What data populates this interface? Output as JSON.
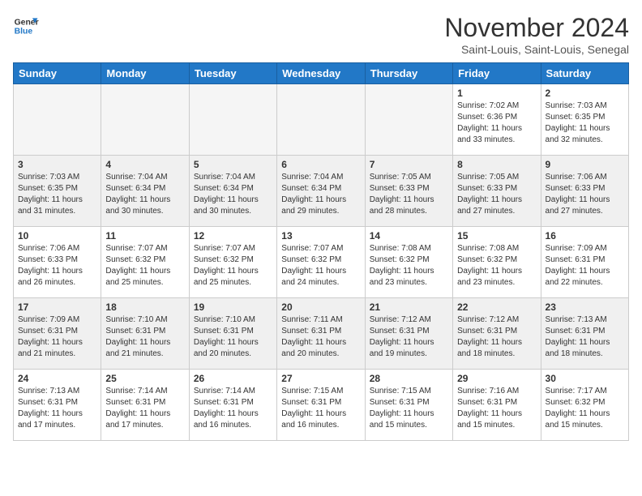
{
  "logo": {
    "line1": "General",
    "line2": "Blue"
  },
  "header": {
    "month": "November 2024",
    "location": "Saint-Louis, Saint-Louis, Senegal"
  },
  "weekdays": [
    "Sunday",
    "Monday",
    "Tuesday",
    "Wednesday",
    "Thursday",
    "Friday",
    "Saturday"
  ],
  "weeks": [
    [
      {
        "day": "",
        "info": "",
        "empty": true
      },
      {
        "day": "",
        "info": "",
        "empty": true
      },
      {
        "day": "",
        "info": "",
        "empty": true
      },
      {
        "day": "",
        "info": "",
        "empty": true
      },
      {
        "day": "",
        "info": "",
        "empty": true
      },
      {
        "day": "1",
        "info": "Sunrise: 7:02 AM\nSunset: 6:36 PM\nDaylight: 11 hours\nand 33 minutes.",
        "empty": false
      },
      {
        "day": "2",
        "info": "Sunrise: 7:03 AM\nSunset: 6:35 PM\nDaylight: 11 hours\nand 32 minutes.",
        "empty": false
      }
    ],
    [
      {
        "day": "3",
        "info": "Sunrise: 7:03 AM\nSunset: 6:35 PM\nDaylight: 11 hours\nand 31 minutes.",
        "empty": false
      },
      {
        "day": "4",
        "info": "Sunrise: 7:04 AM\nSunset: 6:34 PM\nDaylight: 11 hours\nand 30 minutes.",
        "empty": false
      },
      {
        "day": "5",
        "info": "Sunrise: 7:04 AM\nSunset: 6:34 PM\nDaylight: 11 hours\nand 30 minutes.",
        "empty": false
      },
      {
        "day": "6",
        "info": "Sunrise: 7:04 AM\nSunset: 6:34 PM\nDaylight: 11 hours\nand 29 minutes.",
        "empty": false
      },
      {
        "day": "7",
        "info": "Sunrise: 7:05 AM\nSunset: 6:33 PM\nDaylight: 11 hours\nand 28 minutes.",
        "empty": false
      },
      {
        "day": "8",
        "info": "Sunrise: 7:05 AM\nSunset: 6:33 PM\nDaylight: 11 hours\nand 27 minutes.",
        "empty": false
      },
      {
        "day": "9",
        "info": "Sunrise: 7:06 AM\nSunset: 6:33 PM\nDaylight: 11 hours\nand 27 minutes.",
        "empty": false
      }
    ],
    [
      {
        "day": "10",
        "info": "Sunrise: 7:06 AM\nSunset: 6:33 PM\nDaylight: 11 hours\nand 26 minutes.",
        "empty": false
      },
      {
        "day": "11",
        "info": "Sunrise: 7:07 AM\nSunset: 6:32 PM\nDaylight: 11 hours\nand 25 minutes.",
        "empty": false
      },
      {
        "day": "12",
        "info": "Sunrise: 7:07 AM\nSunset: 6:32 PM\nDaylight: 11 hours\nand 25 minutes.",
        "empty": false
      },
      {
        "day": "13",
        "info": "Sunrise: 7:07 AM\nSunset: 6:32 PM\nDaylight: 11 hours\nand 24 minutes.",
        "empty": false
      },
      {
        "day": "14",
        "info": "Sunrise: 7:08 AM\nSunset: 6:32 PM\nDaylight: 11 hours\nand 23 minutes.",
        "empty": false
      },
      {
        "day": "15",
        "info": "Sunrise: 7:08 AM\nSunset: 6:32 PM\nDaylight: 11 hours\nand 23 minutes.",
        "empty": false
      },
      {
        "day": "16",
        "info": "Sunrise: 7:09 AM\nSunset: 6:31 PM\nDaylight: 11 hours\nand 22 minutes.",
        "empty": false
      }
    ],
    [
      {
        "day": "17",
        "info": "Sunrise: 7:09 AM\nSunset: 6:31 PM\nDaylight: 11 hours\nand 21 minutes.",
        "empty": false
      },
      {
        "day": "18",
        "info": "Sunrise: 7:10 AM\nSunset: 6:31 PM\nDaylight: 11 hours\nand 21 minutes.",
        "empty": false
      },
      {
        "day": "19",
        "info": "Sunrise: 7:10 AM\nSunset: 6:31 PM\nDaylight: 11 hours\nand 20 minutes.",
        "empty": false
      },
      {
        "day": "20",
        "info": "Sunrise: 7:11 AM\nSunset: 6:31 PM\nDaylight: 11 hours\nand 20 minutes.",
        "empty": false
      },
      {
        "day": "21",
        "info": "Sunrise: 7:12 AM\nSunset: 6:31 PM\nDaylight: 11 hours\nand 19 minutes.",
        "empty": false
      },
      {
        "day": "22",
        "info": "Sunrise: 7:12 AM\nSunset: 6:31 PM\nDaylight: 11 hours\nand 18 minutes.",
        "empty": false
      },
      {
        "day": "23",
        "info": "Sunrise: 7:13 AM\nSunset: 6:31 PM\nDaylight: 11 hours\nand 18 minutes.",
        "empty": false
      }
    ],
    [
      {
        "day": "24",
        "info": "Sunrise: 7:13 AM\nSunset: 6:31 PM\nDaylight: 11 hours\nand 17 minutes.",
        "empty": false
      },
      {
        "day": "25",
        "info": "Sunrise: 7:14 AM\nSunset: 6:31 PM\nDaylight: 11 hours\nand 17 minutes.",
        "empty": false
      },
      {
        "day": "26",
        "info": "Sunrise: 7:14 AM\nSunset: 6:31 PM\nDaylight: 11 hours\nand 16 minutes.",
        "empty": false
      },
      {
        "day": "27",
        "info": "Sunrise: 7:15 AM\nSunset: 6:31 PM\nDaylight: 11 hours\nand 16 minutes.",
        "empty": false
      },
      {
        "day": "28",
        "info": "Sunrise: 7:15 AM\nSunset: 6:31 PM\nDaylight: 11 hours\nand 15 minutes.",
        "empty": false
      },
      {
        "day": "29",
        "info": "Sunrise: 7:16 AM\nSunset: 6:31 PM\nDaylight: 11 hours\nand 15 minutes.",
        "empty": false
      },
      {
        "day": "30",
        "info": "Sunrise: 7:17 AM\nSunset: 6:32 PM\nDaylight: 11 hours\nand 15 minutes.",
        "empty": false
      }
    ]
  ]
}
